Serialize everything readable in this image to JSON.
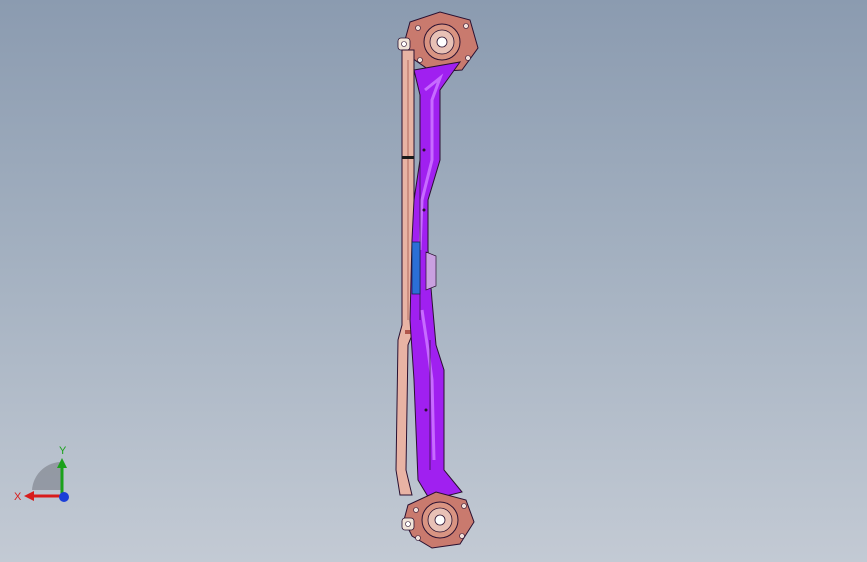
{
  "viewport": {
    "background_top": "#8b9bb0",
    "background_bottom": "#c3cad4"
  },
  "model": {
    "description_icon": "cad-part-icon",
    "colors": {
      "flange": "#c97a6e",
      "flange_dark": "#8a3f37",
      "rail_light": "#e8b3a4",
      "rail_mid": "#d99482",
      "web_purple": "#a020f0",
      "web_purple_light": "#c76bff",
      "edge": "#2a1030",
      "accent_blue": "#2b6fd6"
    }
  },
  "triad": {
    "x_label": "X",
    "y_label": "Y",
    "x_color": "#d81b1b",
    "y_color": "#1ba11b",
    "z_color": "#1b3fd8"
  }
}
